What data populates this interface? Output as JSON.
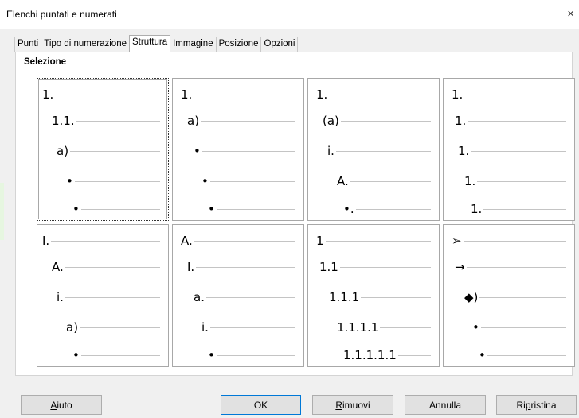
{
  "window": {
    "title": "Elenchi puntati e numerati",
    "close_glyph": "×"
  },
  "tabs": [
    {
      "label": "Punti"
    },
    {
      "label": "Tipo di numerazione"
    },
    {
      "label": "Struttura",
      "active": true
    },
    {
      "label": "Immagine"
    },
    {
      "label": "Posizione"
    },
    {
      "label": "Opzioni"
    }
  ],
  "section_label": "Selezione",
  "presets": [
    {
      "levels": [
        "1.",
        "1.1.",
        "a)",
        "•",
        "•"
      ],
      "selected": true
    },
    {
      "levels": [
        "1.",
        "a)",
        "•",
        "•",
        "•"
      ]
    },
    {
      "levels": [
        "1.",
        "(a)",
        "i.",
        "A.",
        "•."
      ]
    },
    {
      "levels": [
        "1.",
        "1.",
        "1.",
        "1.",
        "1."
      ]
    },
    {
      "levels": [
        "I.",
        "A.",
        "i.",
        "a)",
        "•"
      ]
    },
    {
      "levels": [
        "A.",
        "I.",
        "a.",
        "i.",
        "•"
      ]
    },
    {
      "levels": [
        "1",
        "1.1",
        "1.1.1",
        "1.1.1.1",
        "1.1.1.1.1"
      ]
    },
    {
      "levels": [
        "➢",
        "→",
        "◆)",
        "•",
        "•"
      ]
    }
  ],
  "buttons": {
    "help": {
      "mnemonic": "A",
      "rest": "iuto"
    },
    "ok": "OK",
    "remove": {
      "mnemonic": "R",
      "rest": "imuovi"
    },
    "cancel": "Annulla",
    "reset": {
      "pre": "Ri",
      "mnemonic": "p",
      "rest": "ristina"
    }
  }
}
